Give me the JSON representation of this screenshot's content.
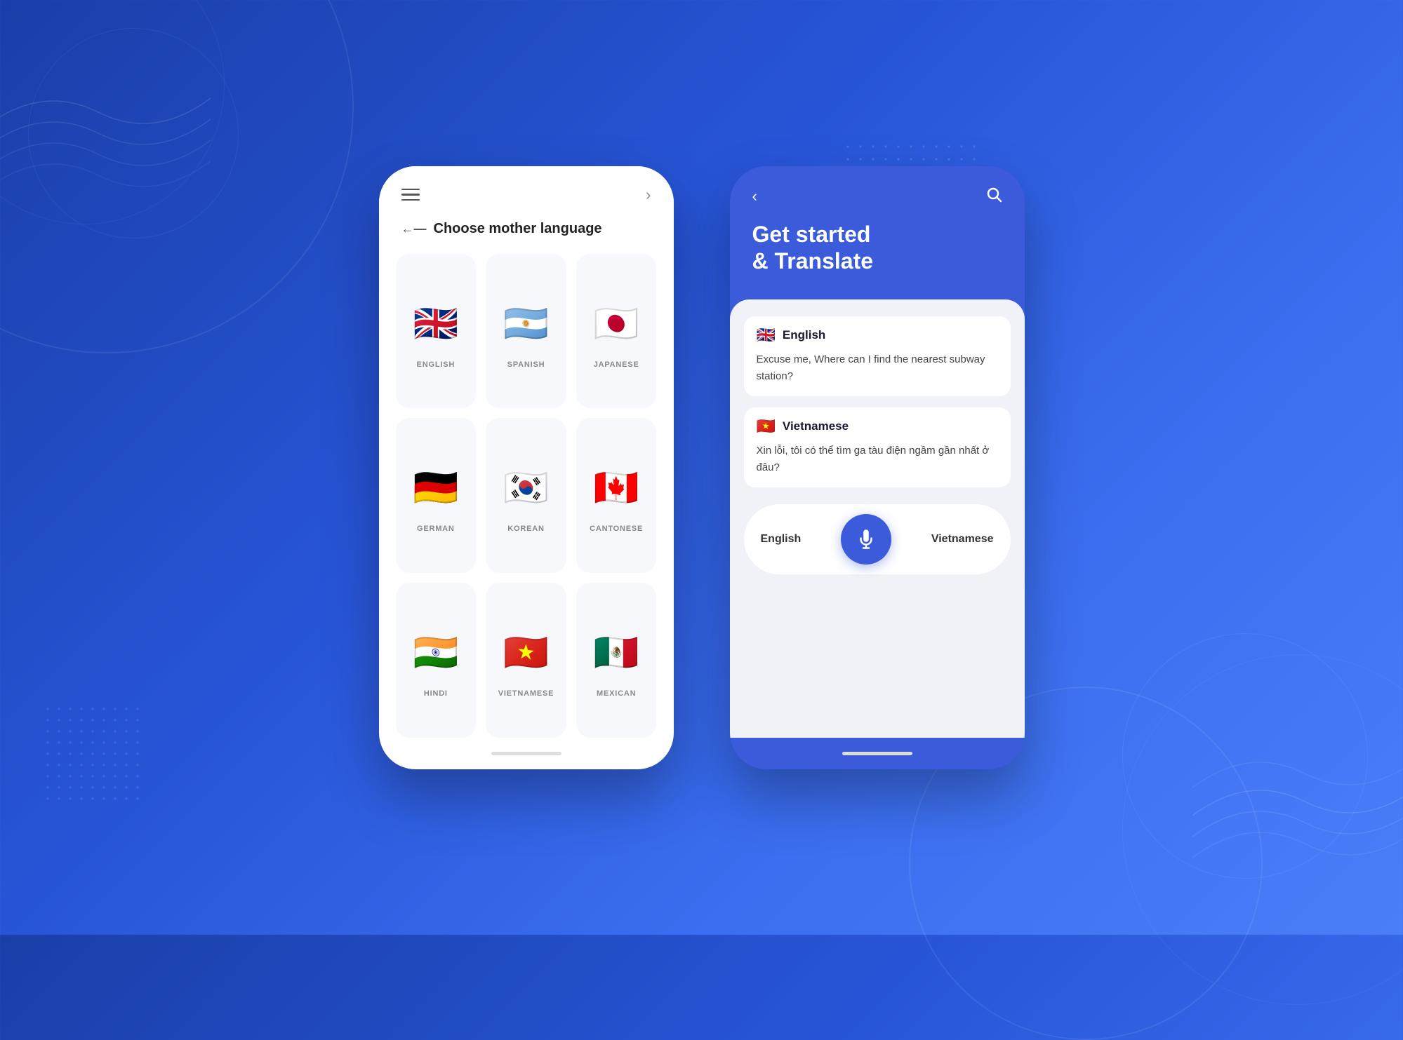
{
  "phone1": {
    "header": {
      "menu_icon": "hamburger",
      "next_icon": "chevron-right"
    },
    "title": "Choose mother language",
    "title_arrow": "←—",
    "languages": [
      {
        "id": "english",
        "label": "ENGLISH",
        "flag_emoji": "🇬🇧"
      },
      {
        "id": "spanish",
        "label": "SPANISH",
        "flag_emoji": "🇦🇷"
      },
      {
        "id": "japanese",
        "label": "JAPANESE",
        "flag_emoji": "🇯🇵"
      },
      {
        "id": "german",
        "label": "GERMAN",
        "flag_emoji": "🇩🇪"
      },
      {
        "id": "korean",
        "label": "KOREAN",
        "flag_emoji": "🇰🇷"
      },
      {
        "id": "cantonese",
        "label": "CANTONESE",
        "flag_emoji": "🇨🇦"
      },
      {
        "id": "hindi",
        "label": "HINDI",
        "flag_emoji": "🇮🇳"
      },
      {
        "id": "vietnamese",
        "label": "VIETNAMESE",
        "flag_emoji": "🇻🇳"
      },
      {
        "id": "mexican",
        "label": "MEXICAN",
        "flag_emoji": "🇲🇽"
      }
    ]
  },
  "phone2": {
    "header": {
      "back_icon": "chevron-left",
      "search_icon": "search"
    },
    "title_line1": "Get started",
    "title_line2": "& Translate",
    "source_lang": {
      "flag_emoji": "🇬🇧",
      "name": "English",
      "text": "Excuse me, Where can I find the nearest subway station?"
    },
    "target_lang": {
      "flag_emoji": "🇻🇳",
      "name": "Vietnamese",
      "text": "Xin lỗi, tôi có thể tìm ga tàu điện ngầm gần nhất ở đâu?"
    },
    "controls": {
      "left_label": "English",
      "right_label": "Vietnamese",
      "mic_icon": "microphone"
    }
  }
}
